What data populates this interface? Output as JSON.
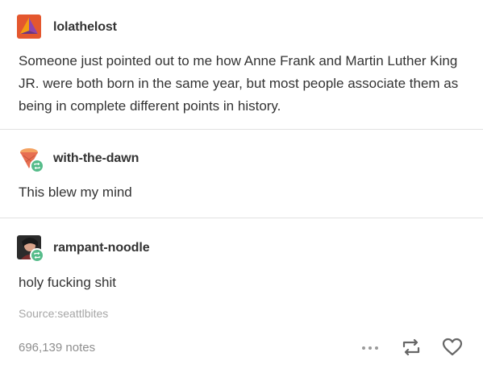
{
  "posts": [
    {
      "username": "lolathelost",
      "text": "Someone just pointed out to me how Anne Frank and Martin Luther King JR. were both born in the same year, but most people associate them as being in complete different points in history.",
      "avatar_icon": "triangle-logo-icon"
    },
    {
      "username": "with-the-dawn",
      "text": "This blew my mind",
      "avatar_icon": "ice-cream-cone-icon",
      "reblogged": true
    },
    {
      "username": "rampant-noodle",
      "text": "holy fucking shit",
      "avatar_icon": "portrait-avatar",
      "reblogged": true
    }
  ],
  "footer": {
    "source": "Source:seattlbites",
    "notes": "696,139 notes",
    "icons": [
      "more-options-icon",
      "reblog-icon",
      "like-heart-icon"
    ]
  },
  "colors": {
    "reblog_badge": "#56bc8a",
    "text": "#333333",
    "muted": "#8e8e8e",
    "divider": "#e1e1e1"
  }
}
